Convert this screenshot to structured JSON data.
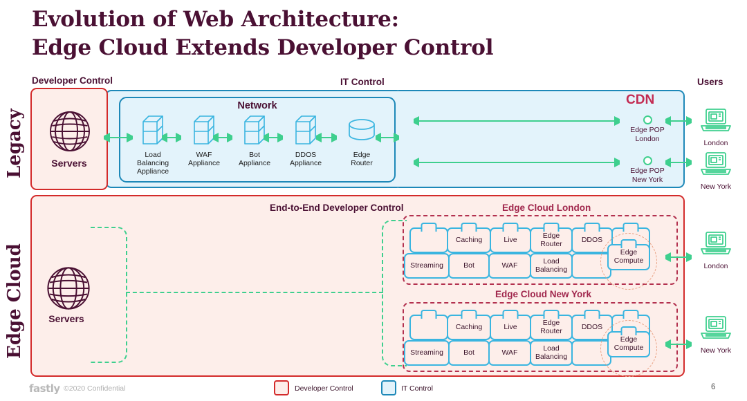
{
  "slide": {
    "title_line1": "Evolution of Web Architecture:",
    "title_line2": "Edge Cloud Extends Developer Control",
    "page_number": "6"
  },
  "headers": {
    "developer_control": "Developer Control",
    "it_control": "IT Control",
    "users": "Users"
  },
  "row_labels": {
    "legacy": "Legacy",
    "edge_cloud": "Edge Cloud"
  },
  "legacy": {
    "servers_label": "Servers",
    "network_label": "Network",
    "cdn_label": "CDN",
    "appliances": [
      {
        "name": "Load Balancing Appliance",
        "line1": "Load",
        "line2": "Balancing",
        "line3": "Appliance",
        "icon": "server-box-icon"
      },
      {
        "name": "WAF Appliance",
        "line1": "WAF",
        "line2": "Appliance",
        "line3": "",
        "icon": "server-box-icon"
      },
      {
        "name": "Bot Appliance",
        "line1": "Bot",
        "line2": "Appliance",
        "line3": "",
        "icon": "server-box-icon"
      },
      {
        "name": "DDOS Appliance",
        "line1": "DDOS",
        "line2": "Appliance",
        "line3": "",
        "icon": "server-box-icon"
      },
      {
        "name": "Edge Router",
        "line1": "Edge",
        "line2": "Router",
        "line3": "",
        "icon": "cylinder-icon"
      }
    ],
    "pops": [
      {
        "line1": "Edge POP",
        "line2": "London"
      },
      {
        "line1": "Edge POP",
        "line2": "New York"
      }
    ],
    "users": [
      {
        "label": "London"
      },
      {
        "label": "New York"
      }
    ]
  },
  "edge_cloud": {
    "servers_label": "Servers",
    "e2e_label": "End-to-End Developer Control",
    "regions": [
      {
        "name": "Edge Cloud London",
        "row_top": [
          "",
          "Caching",
          "Live",
          "Edge Router",
          "DDOS",
          ""
        ],
        "row_bottom": [
          "Streaming",
          "Bot",
          "WAF",
          "Load Balancing",
          ""
        ],
        "edge_compute": "Edge Compute"
      },
      {
        "name": "Edge Cloud New York",
        "row_top": [
          "",
          "Caching",
          "Live",
          "Edge Router",
          "DDOS",
          ""
        ],
        "row_bottom": [
          "Streaming",
          "Bot",
          "WAF",
          "Load Balancing",
          ""
        ],
        "edge_compute": "Edge Compute"
      }
    ],
    "users": [
      {
        "label": "London"
      },
      {
        "label": "New York"
      }
    ]
  },
  "footer": {
    "logo": "fastly",
    "copyright": "©2020 Confidential",
    "legend": [
      {
        "label": "Developer Control",
        "fill": "#fdeeea",
        "stroke": "#d32a2a"
      },
      {
        "label": "IT Control",
        "fill": "#e3f3fb",
        "stroke": "#1d88b8"
      }
    ]
  },
  "colors": {
    "plum": "#4a1033",
    "red": "#d32a2a",
    "blue": "#1d88b8",
    "light_blue_fill": "#e3f3fb",
    "pink_fill": "#fdeeea",
    "green": "#3ecf8e",
    "crimson": "#c32b52",
    "tile_border": "#3ab5e0",
    "region_dash": "#b3314f",
    "compute_circle": "#e9a183"
  }
}
